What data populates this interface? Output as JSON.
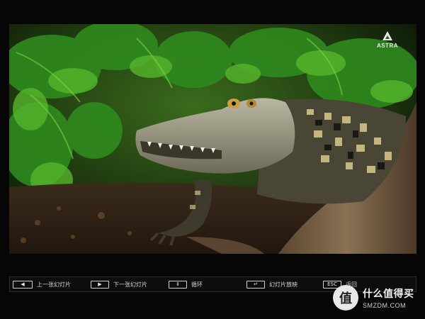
{
  "slide": {
    "image_alt": "caiman in jungle",
    "logo_text": "ASTRA"
  },
  "controls": [
    {
      "key": "◀",
      "label": "上一张幻灯片"
    },
    {
      "key": "▶",
      "label": "下一张幻灯片"
    },
    {
      "key": "⇕",
      "label": "循环"
    },
    {
      "key": "↵",
      "label": "幻灯片放映"
    },
    {
      "key": "ESC",
      "label": "返回"
    }
  ],
  "watermark": {
    "badge": "值",
    "name": "什么值得买",
    "site": "SMZDM.COM"
  }
}
